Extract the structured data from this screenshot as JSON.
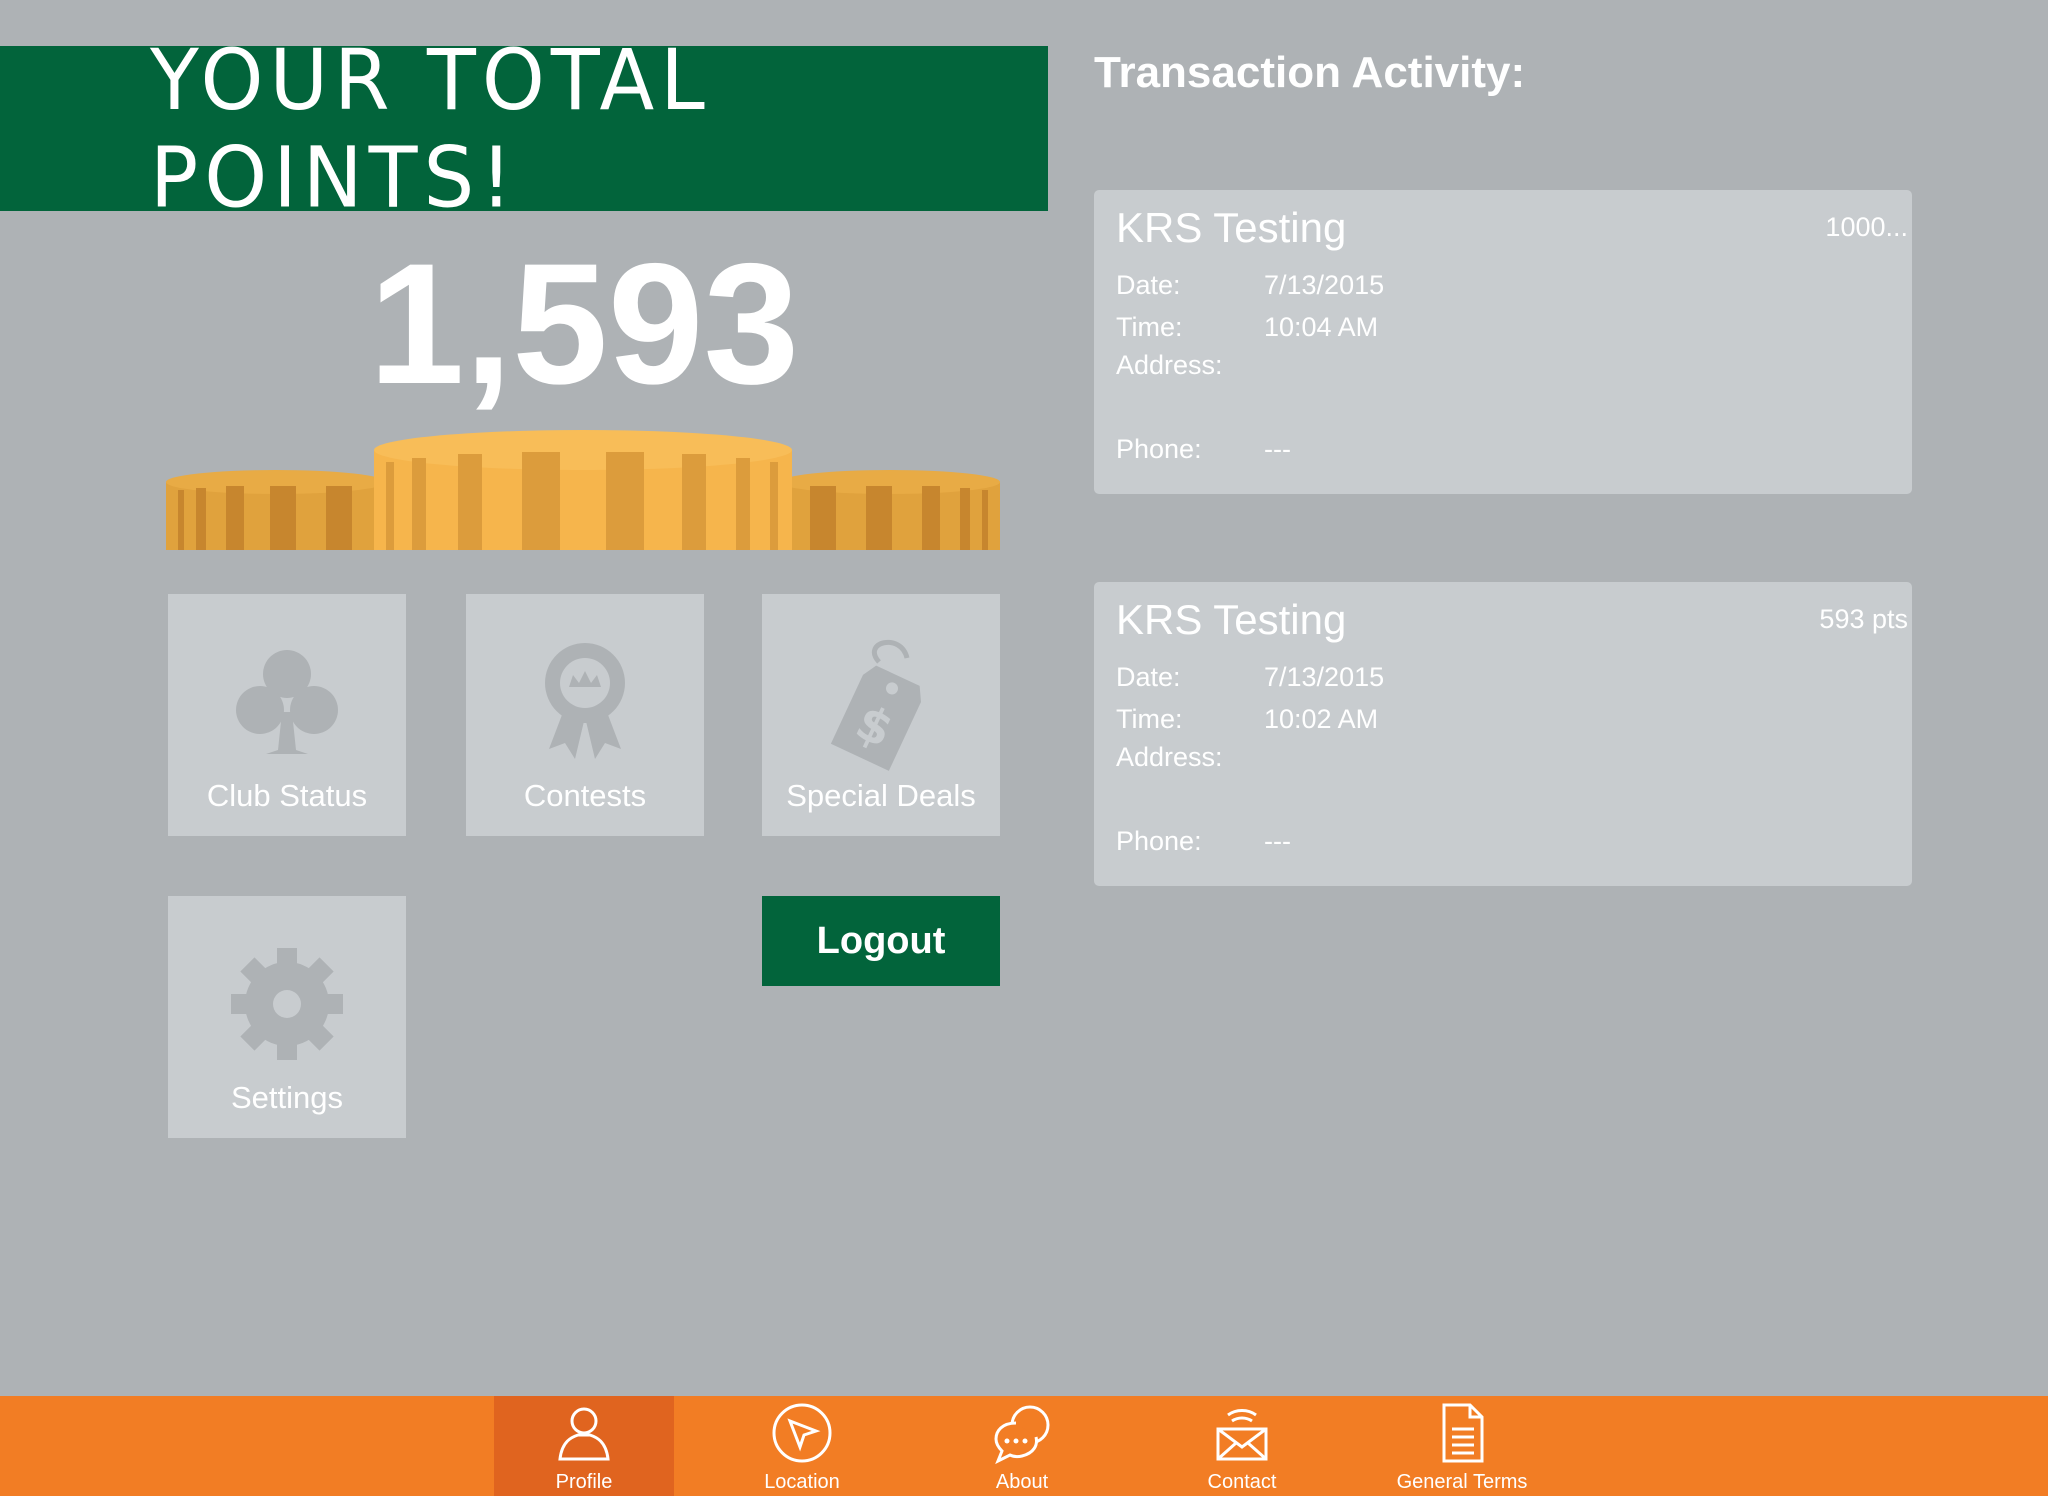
{
  "banner": {
    "title": "YOUR TOTAL POINTS!"
  },
  "points": {
    "total": "1,593"
  },
  "tiles": [
    {
      "label": "Club Status",
      "icon": "club-icon"
    },
    {
      "label": "Contests",
      "icon": "ribbon-award-icon"
    },
    {
      "label": "Special Deals",
      "icon": "price-tag-icon"
    },
    {
      "label": "Settings",
      "icon": "gear-icon"
    }
  ],
  "logout": {
    "label": "Logout"
  },
  "transactions": {
    "title": "Transaction Activity:",
    "labels": {
      "date": "Date:",
      "time": "Time:",
      "address": "Address:",
      "phone": "Phone:"
    },
    "items": [
      {
        "merchant": "KRS Testing",
        "amount": "1000...",
        "date": "7/13/2015",
        "time": "10:04 AM",
        "address": "",
        "phone": "---"
      },
      {
        "merchant": "KRS Testing",
        "amount": "593 pts",
        "date": "7/13/2015",
        "time": "10:02 AM",
        "address": "",
        "phone": "---"
      }
    ]
  },
  "tabbar": {
    "items": [
      {
        "label": "Profile",
        "icon": "person-icon",
        "active": true
      },
      {
        "label": "Location",
        "icon": "compass-icon",
        "active": false
      },
      {
        "label": "About",
        "icon": "chat-bubbles-icon",
        "active": false
      },
      {
        "label": "Contact",
        "icon": "mail-icon",
        "active": false
      },
      {
        "label": "General Terms",
        "icon": "document-icon",
        "active": false
      }
    ]
  },
  "colors": {
    "background": "#aeb2b5",
    "green": "#02643b",
    "orange": "#f27d24",
    "orange_active": "#e0641f",
    "tile": "#c8cccf",
    "gold": "#f6b54c"
  }
}
